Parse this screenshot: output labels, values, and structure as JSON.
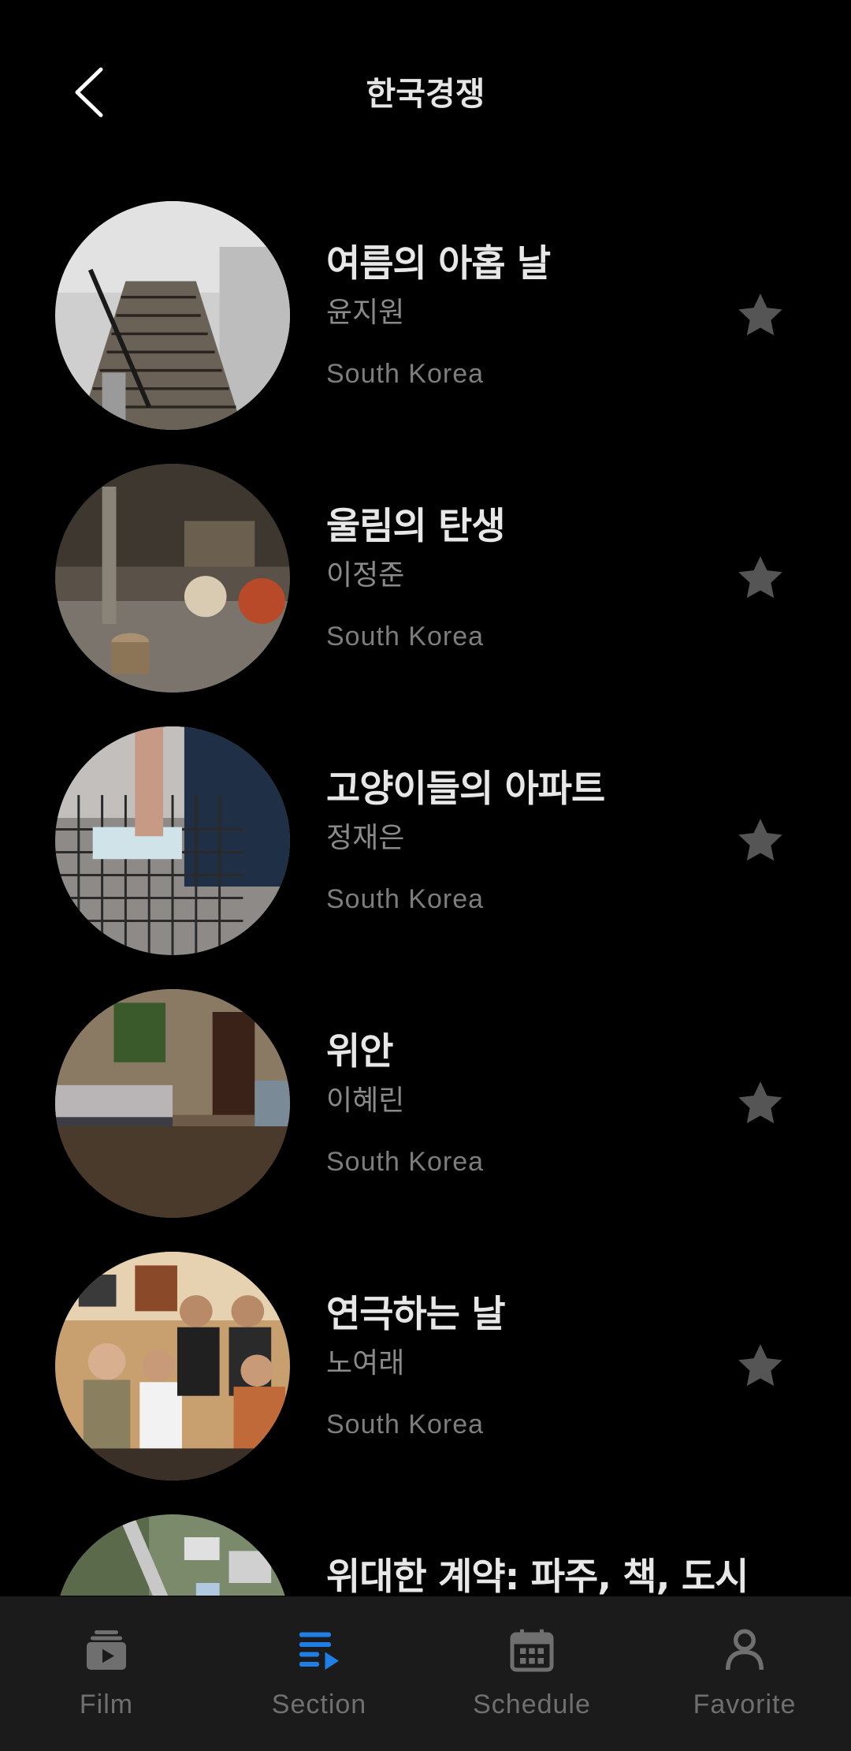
{
  "header": {
    "title": "한국경쟁"
  },
  "films": [
    {
      "title": "여름의 아홉 날",
      "director": "윤지원",
      "country": "South Korea"
    },
    {
      "title": "울림의 탄생",
      "director": "이정준",
      "country": "South Korea"
    },
    {
      "title": "고양이들의 아파트",
      "director": "정재은",
      "country": "South Korea"
    },
    {
      "title": "위안",
      "director": "이혜린",
      "country": "South Korea"
    },
    {
      "title": "연극하는 날",
      "director": "노여래",
      "country": "South Korea"
    },
    {
      "title": "위대한 계약: 파주, 책, 도시",
      "director": "",
      "country": ""
    }
  ],
  "nav": {
    "items": [
      {
        "label": "Film",
        "icon": "film-icon",
        "active": false
      },
      {
        "label": "Section",
        "icon": "section-list-icon",
        "active": true
      },
      {
        "label": "Schedule",
        "icon": "calendar-icon",
        "active": false
      },
      {
        "label": "Favorite",
        "icon": "person-icon",
        "active": false
      }
    ]
  },
  "colors": {
    "accent": "#1f7fe6",
    "star": "#555555",
    "nav_bg": "#1b1b1b"
  }
}
